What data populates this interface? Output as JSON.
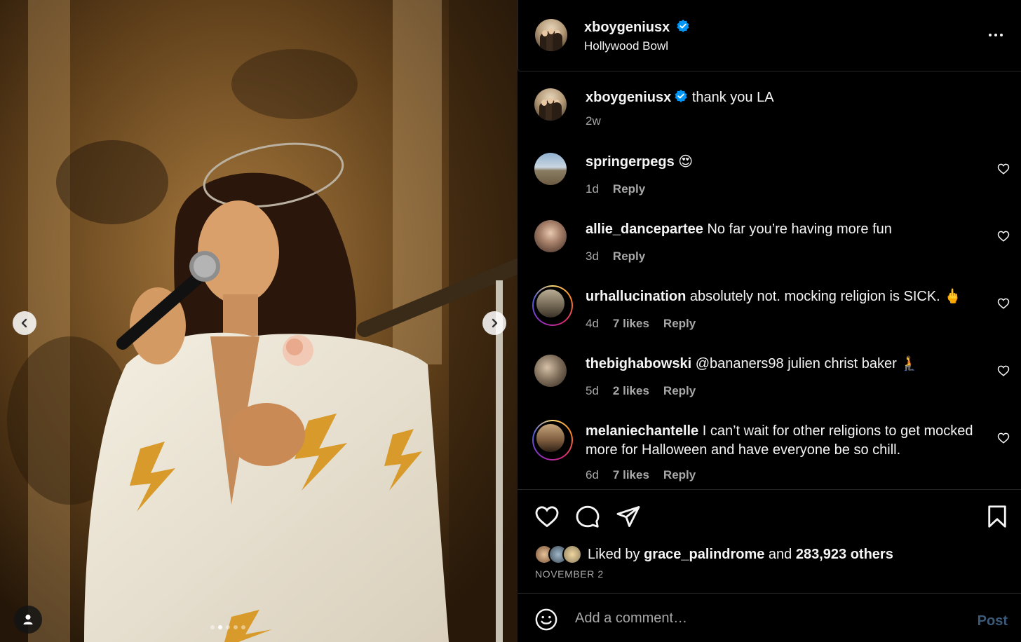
{
  "post": {
    "author": "xboygeniusx",
    "verified": true,
    "location": "Hollywood Bowl",
    "caption": "thank you LA",
    "caption_age": "2w"
  },
  "comments": [
    {
      "user": "springerpegs",
      "text": "😍",
      "age": "1d",
      "likes": "",
      "reply": "Reply"
    },
    {
      "user": "allie_dancepartee",
      "text": "No far you’re having more fun",
      "age": "3d",
      "likes": "",
      "reply": "Reply"
    },
    {
      "user": "urhallucination",
      "text": "absolutely not. mocking religion is SICK. 🖕",
      "age": "4d",
      "likes": "7 likes",
      "reply": "Reply"
    },
    {
      "user": "thebighabowski",
      "text": "@bananers98 julien christ baker 🧎",
      "age": "5d",
      "likes": "2 likes",
      "reply": "Reply"
    },
    {
      "user": "melaniechantelle",
      "text": "I can’t wait for other religions to get mocked more for Halloween and have everyone be so chill.",
      "age": "6d",
      "likes": "7 likes",
      "reply": "Reply"
    }
  ],
  "likes": {
    "prefix": "Liked by",
    "first_user": "grace_palindrome",
    "joiner": "and",
    "others": "283,923 others"
  },
  "date": "NOVEMBER 2",
  "add_comment": {
    "placeholder": "Add a comment…",
    "post_label": "Post"
  },
  "colors": {
    "verified": "#0095f6",
    "muted": "#a8a8a8",
    "divider": "#262626",
    "post_disabled": "#3b5a7a"
  },
  "icons": [
    "verified-icon",
    "more-icon",
    "heart-icon",
    "comment-icon",
    "share-icon",
    "bookmark-icon",
    "emoji-icon",
    "chevron-left-icon",
    "chevron-right-icon",
    "user-tag-icon"
  ],
  "carousel": {
    "slides": 5,
    "active_slide": 2
  }
}
